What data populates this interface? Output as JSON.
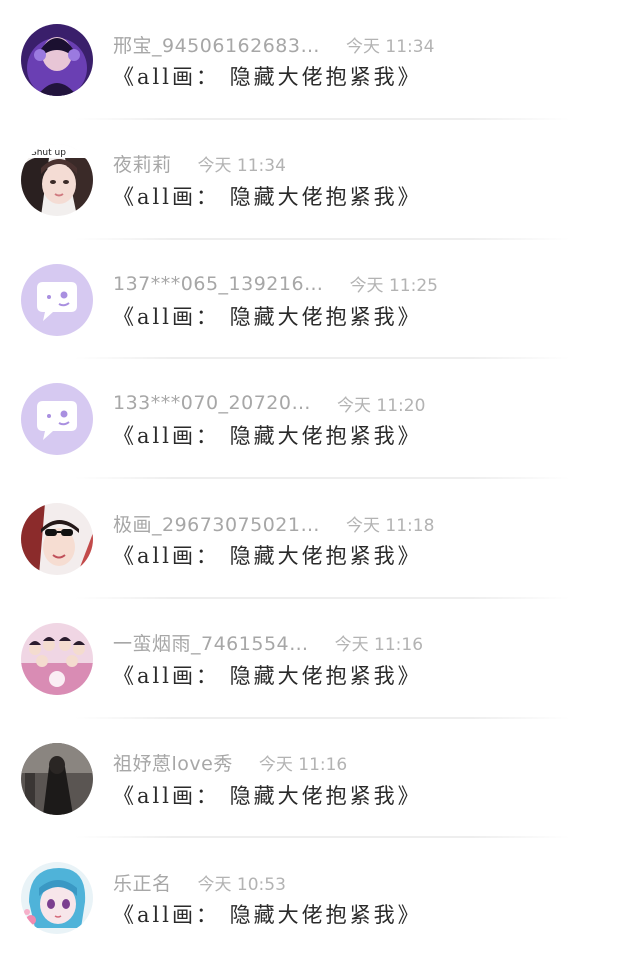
{
  "messages": [
    {
      "avatar": "user-photo-purple-headphones",
      "name": "邢宝_94506162683…",
      "time": "今天 11:34",
      "content": "《all画： 隐藏大佬抱紧我》"
    },
    {
      "avatar": "user-photo-shut-up",
      "avatar_caption": "Shut up",
      "name": "夜莉莉",
      "time": "今天 11:34",
      "content": "《all画： 隐藏大佬抱紧我》"
    },
    {
      "avatar": "default-chat-bubble-avatar",
      "name": "137***065_139216…",
      "time": "今天 11:25",
      "content": "《all画： 隐藏大佬抱紧我》"
    },
    {
      "avatar": "default-chat-bubble-avatar",
      "name": "133***070_20720…",
      "time": "今天 11:20",
      "content": "《all画： 隐藏大佬抱紧我》"
    },
    {
      "avatar": "user-photo-sunglasses",
      "name": "极画_29673075021…",
      "time": "今天 11:18",
      "content": "《all画： 隐藏大佬抱紧我》"
    },
    {
      "avatar": "user-photo-group",
      "name": "一蛮烟雨_7461554…",
      "time": "今天 11:16",
      "content": "《all画： 隐藏大佬抱紧我》"
    },
    {
      "avatar": "user-photo-dark-silhouette",
      "name": "祖妤蒽love秀",
      "time": "今天 11:16",
      "content": "《all画： 隐藏大佬抱紧我》"
    },
    {
      "avatar": "user-photo-anime-girl-blue-hair",
      "name": "乐正名",
      "time": "今天 10:53",
      "content": "《all画： 隐藏大佬抱紧我》"
    }
  ],
  "colors": {
    "name": "#a7a7a7",
    "time": "#b3b3b3",
    "content": "#2a2a2a",
    "default_avatar_bg": "#d6c9f1",
    "default_avatar_accent": "#a98fe0"
  }
}
